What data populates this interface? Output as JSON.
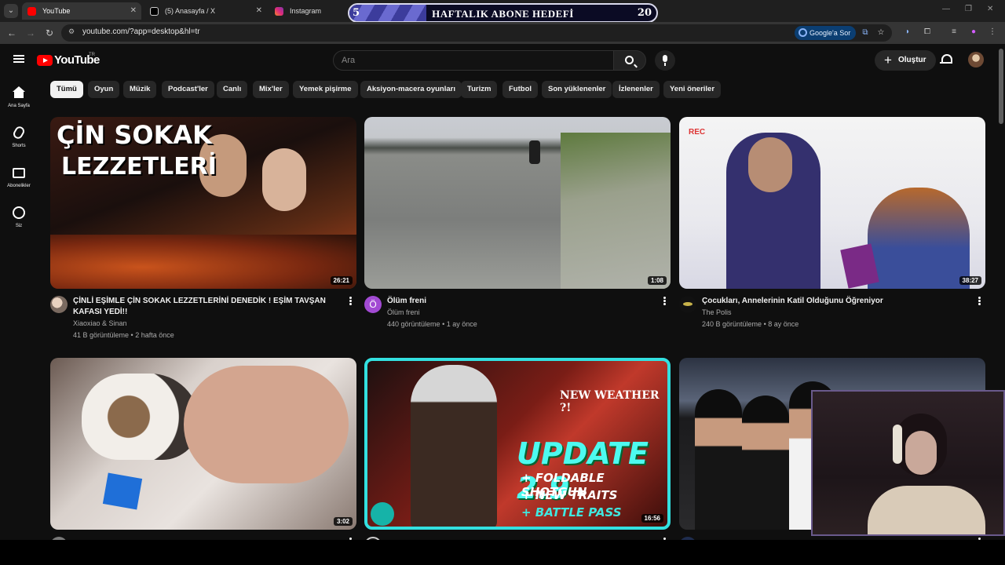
{
  "browser": {
    "tabs": [
      {
        "title": "YouTube",
        "active": true,
        "favicon_color": "#ff0000"
      },
      {
        "title": "(5) Anasayfa / X",
        "active": false,
        "favicon_color": "#000000"
      },
      {
        "title": "Instagram",
        "active": false,
        "favicon_color": "#d6249f"
      }
    ],
    "url": "youtube.com/?app=desktop&hl=tr",
    "ask_google": "Google'a Sor"
  },
  "overlay_goal": {
    "start": "5",
    "title": "HAFTALIK ABONE HEDEFİ",
    "end": "20",
    "progress": 0.25
  },
  "youtube": {
    "logo_text": "YouTube",
    "logo_country": "TR",
    "search_placeholder": "Ara",
    "create_label": "Oluştur",
    "sidebar": [
      {
        "icon": "home-icon",
        "label": "Ana Sayfa"
      },
      {
        "icon": "shorts-icon",
        "label": "Shorts"
      },
      {
        "icon": "subscriptions-icon",
        "label": "Abonelikler"
      },
      {
        "icon": "you-icon",
        "label": "Siz"
      }
    ],
    "chips": [
      "Tümü",
      "Oyun",
      "Müzik",
      "Podcast'ler",
      "Canlı",
      "Mix'ler",
      "Yemek pişirme",
      "Aksiyon-macera oyunları",
      "Turizm",
      "Futbol",
      "Son yüklenenler",
      "İzlenenler",
      "Yeni öneriler"
    ],
    "selected_chip": "Tümü",
    "videos": [
      {
        "title": "ÇİNLİ EŞİMLE ÇİN SOKAK LEZZETLERİNİ DENEDİK ! EŞİM TAVŞAN KAFASI YEDİ!!",
        "channel": "Xiaoxiao & Sinan",
        "views": "41 B görüntüleme",
        "age": "2 hafta önce",
        "duration": "26:21",
        "thumb_text": [
          "ÇİN SOKAK",
          "LEZZETLERİ"
        ]
      },
      {
        "title": "Ölüm freni",
        "channel": "Ölüm freni",
        "views": "440 görüntüleme",
        "age": "1 ay önce",
        "duration": "1:08",
        "avatar_letter": "Ö"
      },
      {
        "title": "Çocukları, Annelerinin Katil Olduğunu Öğreniyor",
        "channel": "The Polis",
        "views": "240 B görüntüleme",
        "age": "8 ay önce",
        "duration": "38:27",
        "thumb_text": [
          "REC"
        ]
      },
      {
        "duration": "3:02"
      },
      {
        "duration": "16:56",
        "thumb_text": [
          "NEW WEATHER ?!",
          "UPDATE 2.9",
          "+ FOLDABLE SHOTGUN",
          "+ NEW TRAITS",
          "+ BATTLE PASS"
        ]
      },
      {}
    ]
  }
}
